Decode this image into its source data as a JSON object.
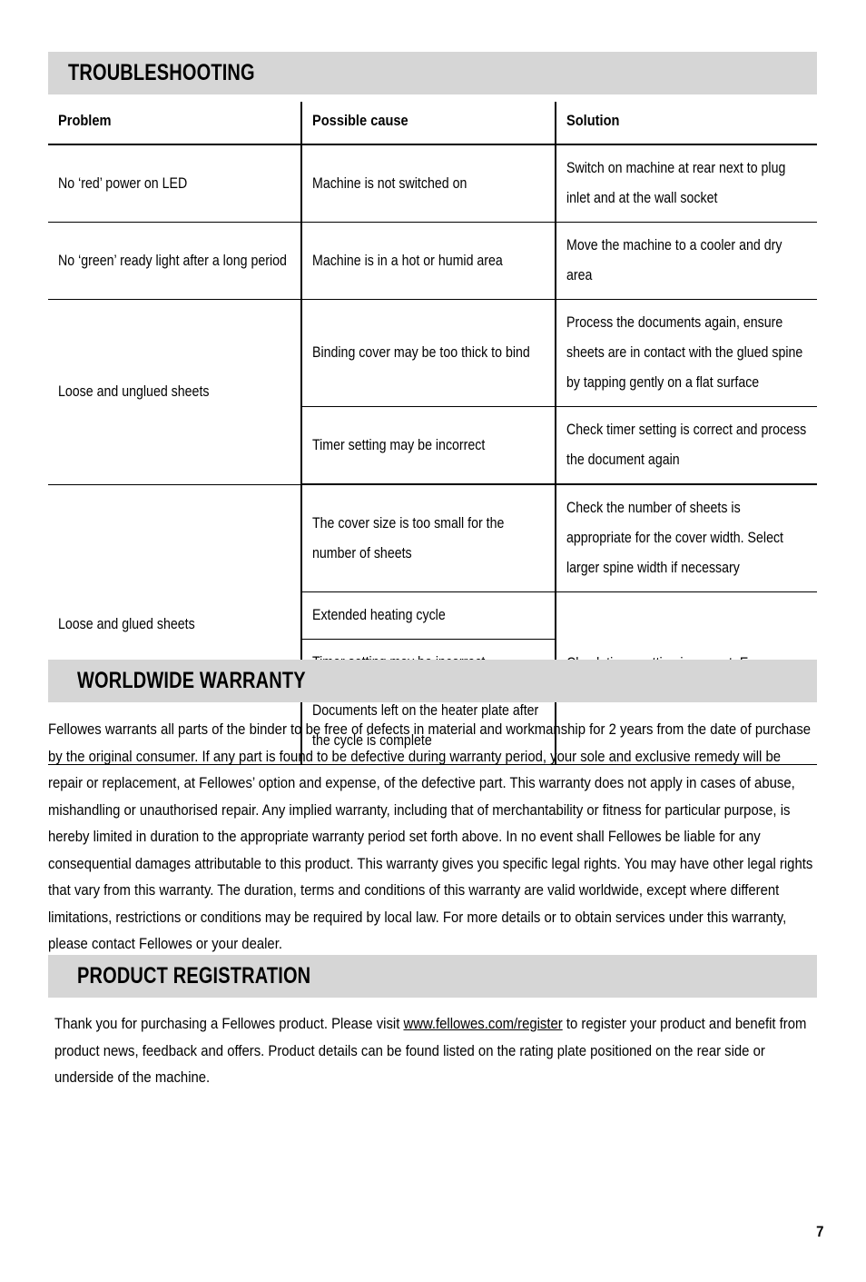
{
  "document": {
    "page_number": "7",
    "band_color": "#d6d6d6"
  },
  "troubleshooting": {
    "heading": "TROUBLESHOOTING",
    "columns": {
      "problem": "Problem",
      "cause": "Possible cause",
      "solution": "Solution"
    },
    "rows": [
      {
        "problem": "No ‘red’ power on LED",
        "cause": "Machine is not switched on",
        "solution": "Switch on machine at rear next to plug inlet and at the wall socket"
      },
      {
        "problem": "No ‘green’ ready light after a long period",
        "cause": "Machine is in a hot or humid area",
        "solution": "Move the machine to a cooler and dry area"
      },
      {
        "problem": "Loose and unglued sheets",
        "cause": "Binding cover may be too thick to bind",
        "solution": "Process the documents again, ensure sheets are in contact with the glued spine by tapping gently on a flat surface"
      },
      {
        "problem": "",
        "cause": "Timer setting may be incorrect",
        "solution": "Check timer setting is correct and process the document again"
      },
      {
        "problem": "Loose and glued sheets",
        "cause": "The cover size is too small for the number of sheets",
        "solution": "Check the number of sheets is appropriate for the cover width. Select larger spine width if necessary"
      },
      {
        "problem": "",
        "cause": "Extended heating cycle",
        "solution": "Check timer setting is correct. Ensure prompt document removal"
      },
      {
        "problem": "",
        "cause": "Timer setting may be incorrect",
        "solution": ""
      },
      {
        "problem": "",
        "cause": "Documents left on the heater plate after the cycle is complete",
        "solution": ""
      }
    ]
  },
  "warranty": {
    "heading": "WORLDWIDE WARRANTY",
    "body": "Fellowes warrants all parts of the binder to be free of defects in material and workmanship for 2 years from the date of purchase by the original consumer. If any part is found to be defective during warranty period, your sole and exclusive remedy will be repair or replacement, at Fellowes’ option and expense, of the defective part. This warranty does not apply in cases of abuse, mishandling or unauthorised repair. Any implied warranty, including that of merchantability or fitness for particular purpose, is hereby limited in duration to the appropriate warranty period set forth above. In no event shall Fellowes be liable for any consequential damages attributable to this product. This warranty gives you specific legal rights. You may have other legal rights that vary from this warranty. The duration, terms and conditions of this warranty are valid worldwide, except where different limitations, restrictions or conditions may be required by local law. For more details or to obtain services under this warranty, please contact Fellowes or your dealer."
  },
  "registration": {
    "heading": "PRODUCT REGISTRATION",
    "body_before_link": "Thank you for purchasing a Fellowes product. Please visit ",
    "link_text": "www.fellowes.com/register",
    "body_after_link": " to register your product and benefit from product news, feedback and offers. Product details can be found listed on the rating plate positioned on the rear side or underside of the machine."
  }
}
